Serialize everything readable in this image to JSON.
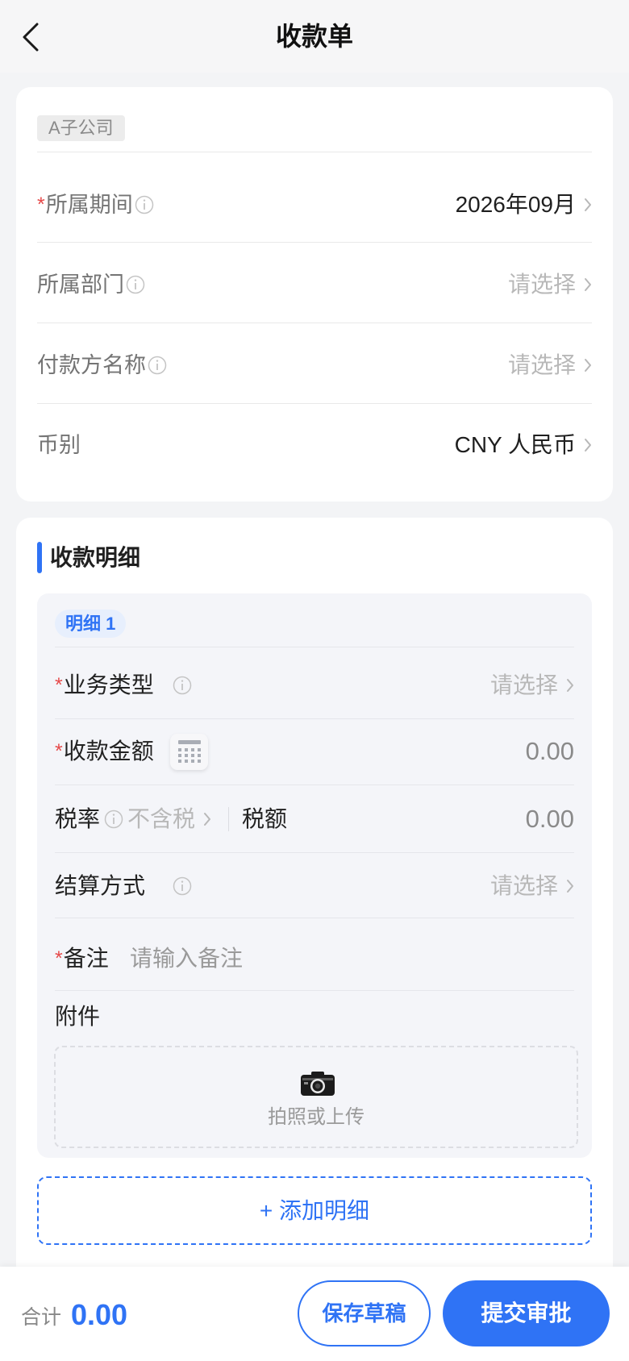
{
  "header": {
    "title": "收款单"
  },
  "icons": {
    "back": "chevron-left-icon",
    "info": "info-circle-icon",
    "chevron": "chevron-right-icon",
    "calculator": "calculator-icon",
    "camera": "camera-icon"
  },
  "required_mark": "*",
  "company": {
    "badge": "A子公司"
  },
  "form": {
    "period": {
      "label": "所属期间",
      "value": "2026年09月"
    },
    "department": {
      "label": "所属部门",
      "value": "请选择"
    },
    "payer": {
      "label": "付款方名称",
      "value": "请选择"
    },
    "currency": {
      "label": "币别",
      "value": "CNY 人民币"
    }
  },
  "details": {
    "title": "收款明细",
    "items": [
      {
        "tag": "明细 1",
        "business_type": {
          "label": "业务类型",
          "value": "请选择"
        },
        "amount": {
          "label": "收款金额",
          "value": "0.00"
        },
        "tax_rate": {
          "label": "税率",
          "value": "不含税"
        },
        "tax_amount": {
          "label": "税额",
          "value": "0.00"
        },
        "settlement": {
          "label": "结算方式",
          "value": "请选择"
        },
        "remark": {
          "label": "备注",
          "placeholder": "请输入备注"
        },
        "attachment": {
          "label": "附件",
          "upload_label": "拍照或上传"
        }
      }
    ],
    "add_button": "+ 添加明细"
  },
  "footer": {
    "total_label": "合计",
    "total_value": "0.00",
    "draft_button": "保存草稿",
    "submit_button": "提交审批"
  },
  "colors": {
    "accent": "#2f73f5",
    "required": "#e64a4a",
    "page_bg": "#f3f4f6",
    "detail_bg": "#f4f5f9"
  }
}
